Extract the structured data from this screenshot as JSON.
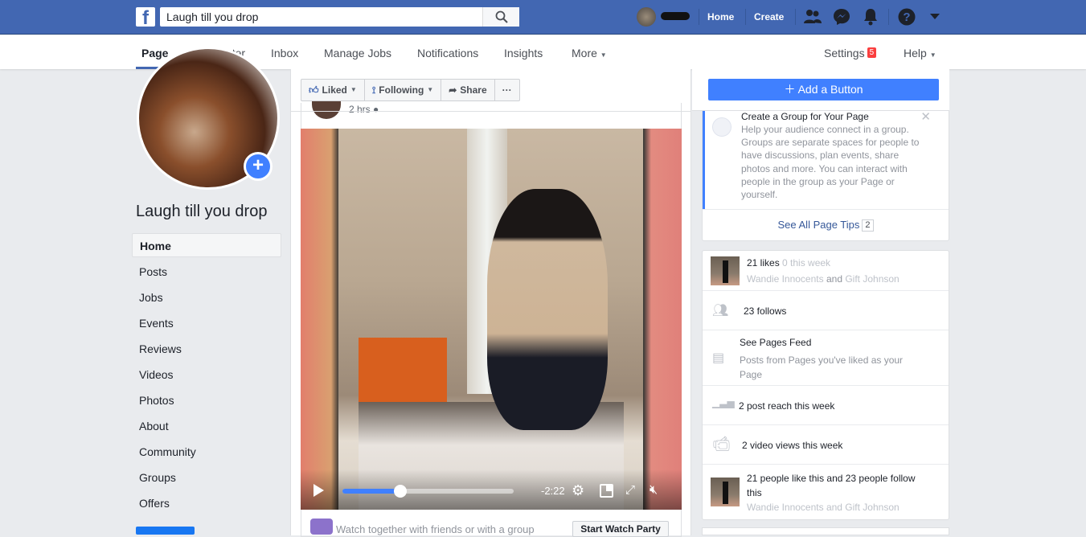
{
  "topbar": {
    "search_value": "Laugh till you drop",
    "search_placeholder": "Search",
    "home": "Home",
    "create": "Create",
    "brand_color": "#4267b2"
  },
  "nav": {
    "items": [
      "Page",
      "Ad Center",
      "Inbox",
      "Manage Jobs",
      "Notifications",
      "Insights",
      "More"
    ],
    "settings": "Settings",
    "settings_badge": "5",
    "help": "Help"
  },
  "sidebar": {
    "page_name": "Laugh till you drop",
    "items": [
      "Home",
      "Posts",
      "Jobs",
      "Events",
      "Reviews",
      "Videos",
      "Photos",
      "About",
      "Community",
      "Groups",
      "Offers"
    ]
  },
  "actions": {
    "liked": "Liked",
    "following": "Following",
    "share": "Share",
    "more": "···"
  },
  "post": {
    "time": "2 hrs",
    "video_time": "-2:22",
    "progress": 0.34,
    "watch_text": "Watch together with friends or with a group",
    "watch_button": "Start Watch Party"
  },
  "right": {
    "add_button": "Add a Button",
    "tip_title": "Create a Group for Your Page",
    "tip_body": "Help your audience connect in a group. Groups are separate spaces for people to have discussions, plan events, share photos and more. You can interact with people in the group as your Page or yourself.",
    "see_all_tips": "See All Page Tips",
    "tips_count": "2",
    "likes": "21 likes",
    "likes_week": "0 this week",
    "liker1": "Wandie Innocents",
    "and": "and",
    "liker2": "Gift Johnson",
    "follows": "23 follows",
    "feed_title": "See Pages Feed",
    "feed_sub": "Posts from Pages you've liked as your Page",
    "reach": "2 post reach this week",
    "video_views": "2 video views this week",
    "people_summary": "21 people like this and 23 people follow this",
    "people_names": "Wandie Innocents and Gift Johnson",
    "accent": "#4080ff"
  }
}
